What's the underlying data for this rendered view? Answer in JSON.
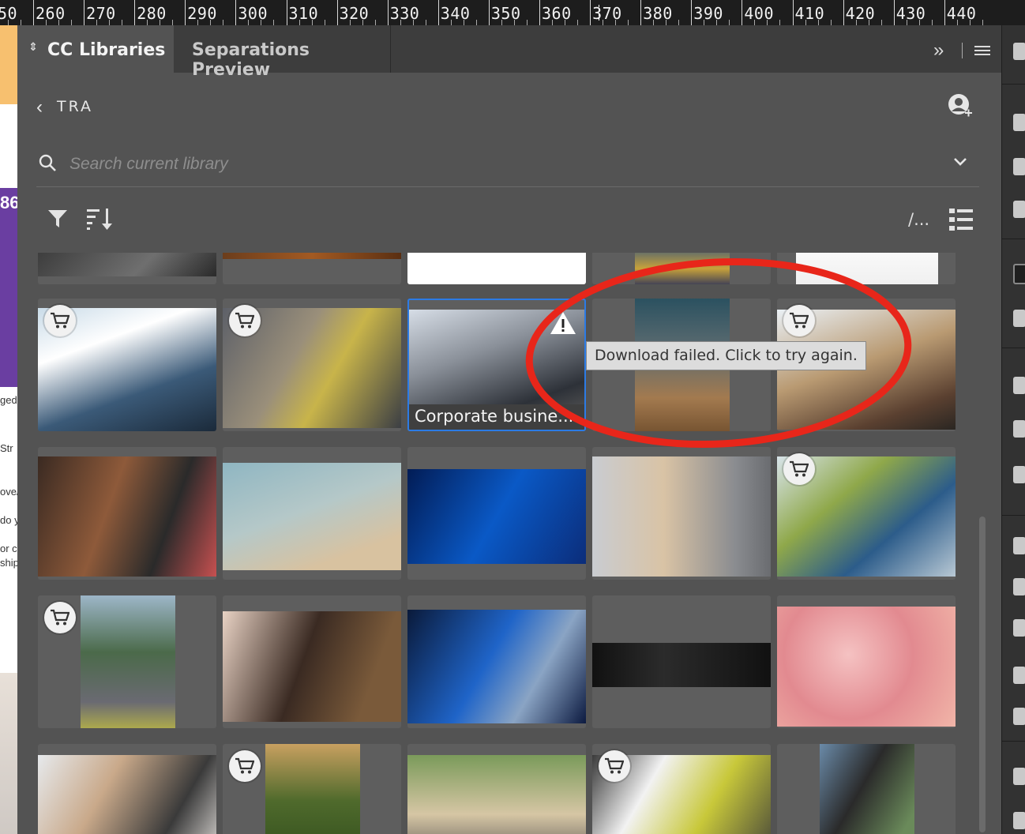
{
  "ruler": {
    "labels": [
      "50",
      "260",
      "270",
      "280",
      "290",
      "300",
      "310",
      "320",
      "330",
      "340",
      "350",
      "360",
      "370",
      "380",
      "390",
      "400",
      "410",
      "420",
      "430",
      "440"
    ]
  },
  "left_strip": {
    "number": "86",
    "fragments": [
      "ged",
      "Str",
      "ove/",
      "do y",
      "or c",
      "ship"
    ]
  },
  "tabs": {
    "active": "CC Libraries",
    "inactive": "Separations Preview",
    "expand_icon": "double-chevron-right-icon",
    "menu_icon": "hamburger-icon"
  },
  "library": {
    "back_icon": "chevron-left-icon",
    "name": "TRA",
    "invite_icon": "add-user-icon"
  },
  "search": {
    "placeholder": "Search current library",
    "value": "",
    "dropdown_icon": "chevron-down-icon"
  },
  "toolbar": {
    "filter_icon": "filter-icon",
    "sort_icon": "sort-icon",
    "path_label": "/...",
    "view_icon": "list-view-icon"
  },
  "selected_asset": {
    "caption": "Corporate busine...",
    "warning_icon": "warning-icon"
  },
  "tooltip": {
    "text": "Download failed. Click to try again."
  },
  "annotation": {
    "color": "#e8261a",
    "shape": "ellipse"
  },
  "colors": {
    "panel_bg": "#535353",
    "tab_bar": "#3d3d3d",
    "selection": "#2c7be5",
    "cell_bg": "#5e5e5e"
  },
  "grid": {
    "rows": [
      [
        "dark device partial",
        "orange partial",
        "yellow object",
        "workers partial",
        "consistency slide"
      ],
      [
        "engineers pointing",
        "engineer with blueprint",
        "corporate office",
        "card payment",
        "shopping mall"
      ],
      [
        "card terminal",
        "wooden cube",
        "dollar hologram",
        "empty van interior",
        "handshake workers"
      ],
      [
        "street festival",
        "payment terminal",
        "coins chart",
        "light streaks",
        "pink carnations"
      ],
      [
        "older man",
        "farm workers",
        "racing fan",
        "engineers hard hats",
        "store cashier"
      ]
    ],
    "cart_badges": [
      [],
      [
        0,
        1,
        4
      ],
      [
        4
      ],
      [
        0
      ],
      [
        1,
        3
      ]
    ]
  }
}
